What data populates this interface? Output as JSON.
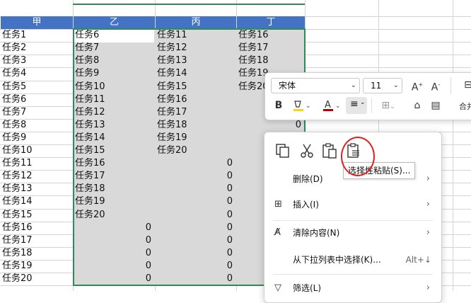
{
  "headers": [
    "甲",
    "乙",
    "丙",
    "丁"
  ],
  "col_a": [
    "任务1",
    "任务2",
    "任务3",
    "任务4",
    "任务5",
    "任务6",
    "任务7",
    "任务8",
    "任务9",
    "任务10",
    "任务11",
    "任务12",
    "任务13",
    "任务14",
    "任务15",
    "任务16",
    "任务17",
    "任务18",
    "任务19",
    "任务20"
  ],
  "col_b": [
    "任务6",
    "任务7",
    "任务8",
    "任务9",
    "任务10",
    "任务11",
    "任务12",
    "任务13",
    "任务14",
    "任务15",
    "任务16",
    "任务17",
    "任务18",
    "任务19",
    "任务20",
    "0",
    "0",
    "0",
    "0",
    "0"
  ],
  "col_c": [
    "任务11",
    "任务12",
    "任务13",
    "任务14",
    "任务15",
    "任务16",
    "任务17",
    "任务18",
    "任务19",
    "任务20",
    "0",
    "0",
    "0",
    "0",
    "0",
    "0",
    "0",
    "0",
    "0",
    "0"
  ],
  "col_d": [
    "任务16",
    "任务17",
    "任务18",
    "任务19",
    "任务20",
    "",
    "",
    "0",
    "",
    "",
    "",
    "",
    "",
    "",
    "",
    "",
    "",
    "",
    "",
    ""
  ],
  "mini_toolbar": {
    "font_name": "宋体",
    "font_size": "11",
    "bold_label": "B",
    "merge_label": "合并"
  },
  "context_menu": {
    "tooltip": "选择性粘贴(S)...",
    "items": [
      {
        "label": "删除(D)",
        "icon": "",
        "has_arrow": true
      },
      {
        "label": "插入(I)",
        "icon": "insert-icon",
        "has_arrow": true
      },
      {
        "label": "清除内容(N)",
        "icon": "eraser-icon",
        "has_arrow": true
      },
      {
        "label": "从下拉列表中选择(K)...",
        "icon": "",
        "shortcut": "Alt+↓"
      },
      {
        "label": "筛选(L)",
        "icon": "filter-icon",
        "has_arrow": true
      }
    ]
  },
  "colors": {
    "header_bg": "#4472c4",
    "selection_border": "#2e8b57",
    "highlight_circle": "#e02020",
    "font_color_red": "#c00000",
    "fill_yellow": "#ffd700"
  }
}
